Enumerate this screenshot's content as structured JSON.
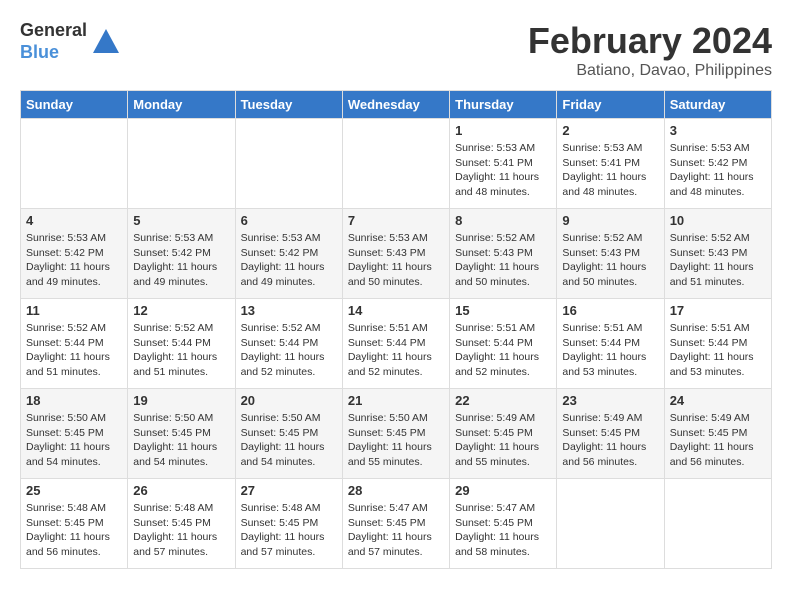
{
  "header": {
    "logo_line1": "General",
    "logo_line2": "Blue",
    "month_year": "February 2024",
    "location": "Batiano, Davao, Philippines"
  },
  "days_of_week": [
    "Sunday",
    "Monday",
    "Tuesday",
    "Wednesday",
    "Thursday",
    "Friday",
    "Saturday"
  ],
  "weeks": [
    [
      {
        "num": "",
        "info": ""
      },
      {
        "num": "",
        "info": ""
      },
      {
        "num": "",
        "info": ""
      },
      {
        "num": "",
        "info": ""
      },
      {
        "num": "1",
        "info": "Sunrise: 5:53 AM\nSunset: 5:41 PM\nDaylight: 11 hours\nand 48 minutes."
      },
      {
        "num": "2",
        "info": "Sunrise: 5:53 AM\nSunset: 5:41 PM\nDaylight: 11 hours\nand 48 minutes."
      },
      {
        "num": "3",
        "info": "Sunrise: 5:53 AM\nSunset: 5:42 PM\nDaylight: 11 hours\nand 48 minutes."
      }
    ],
    [
      {
        "num": "4",
        "info": "Sunrise: 5:53 AM\nSunset: 5:42 PM\nDaylight: 11 hours\nand 49 minutes."
      },
      {
        "num": "5",
        "info": "Sunrise: 5:53 AM\nSunset: 5:42 PM\nDaylight: 11 hours\nand 49 minutes."
      },
      {
        "num": "6",
        "info": "Sunrise: 5:53 AM\nSunset: 5:42 PM\nDaylight: 11 hours\nand 49 minutes."
      },
      {
        "num": "7",
        "info": "Sunrise: 5:53 AM\nSunset: 5:43 PM\nDaylight: 11 hours\nand 50 minutes."
      },
      {
        "num": "8",
        "info": "Sunrise: 5:52 AM\nSunset: 5:43 PM\nDaylight: 11 hours\nand 50 minutes."
      },
      {
        "num": "9",
        "info": "Sunrise: 5:52 AM\nSunset: 5:43 PM\nDaylight: 11 hours\nand 50 minutes."
      },
      {
        "num": "10",
        "info": "Sunrise: 5:52 AM\nSunset: 5:43 PM\nDaylight: 11 hours\nand 51 minutes."
      }
    ],
    [
      {
        "num": "11",
        "info": "Sunrise: 5:52 AM\nSunset: 5:44 PM\nDaylight: 11 hours\nand 51 minutes."
      },
      {
        "num": "12",
        "info": "Sunrise: 5:52 AM\nSunset: 5:44 PM\nDaylight: 11 hours\nand 51 minutes."
      },
      {
        "num": "13",
        "info": "Sunrise: 5:52 AM\nSunset: 5:44 PM\nDaylight: 11 hours\nand 52 minutes."
      },
      {
        "num": "14",
        "info": "Sunrise: 5:51 AM\nSunset: 5:44 PM\nDaylight: 11 hours\nand 52 minutes."
      },
      {
        "num": "15",
        "info": "Sunrise: 5:51 AM\nSunset: 5:44 PM\nDaylight: 11 hours\nand 52 minutes."
      },
      {
        "num": "16",
        "info": "Sunrise: 5:51 AM\nSunset: 5:44 PM\nDaylight: 11 hours\nand 53 minutes."
      },
      {
        "num": "17",
        "info": "Sunrise: 5:51 AM\nSunset: 5:44 PM\nDaylight: 11 hours\nand 53 minutes."
      }
    ],
    [
      {
        "num": "18",
        "info": "Sunrise: 5:50 AM\nSunset: 5:45 PM\nDaylight: 11 hours\nand 54 minutes."
      },
      {
        "num": "19",
        "info": "Sunrise: 5:50 AM\nSunset: 5:45 PM\nDaylight: 11 hours\nand 54 minutes."
      },
      {
        "num": "20",
        "info": "Sunrise: 5:50 AM\nSunset: 5:45 PM\nDaylight: 11 hours\nand 54 minutes."
      },
      {
        "num": "21",
        "info": "Sunrise: 5:50 AM\nSunset: 5:45 PM\nDaylight: 11 hours\nand 55 minutes."
      },
      {
        "num": "22",
        "info": "Sunrise: 5:49 AM\nSunset: 5:45 PM\nDaylight: 11 hours\nand 55 minutes."
      },
      {
        "num": "23",
        "info": "Sunrise: 5:49 AM\nSunset: 5:45 PM\nDaylight: 11 hours\nand 56 minutes."
      },
      {
        "num": "24",
        "info": "Sunrise: 5:49 AM\nSunset: 5:45 PM\nDaylight: 11 hours\nand 56 minutes."
      }
    ],
    [
      {
        "num": "25",
        "info": "Sunrise: 5:48 AM\nSunset: 5:45 PM\nDaylight: 11 hours\nand 56 minutes."
      },
      {
        "num": "26",
        "info": "Sunrise: 5:48 AM\nSunset: 5:45 PM\nDaylight: 11 hours\nand 57 minutes."
      },
      {
        "num": "27",
        "info": "Sunrise: 5:48 AM\nSunset: 5:45 PM\nDaylight: 11 hours\nand 57 minutes."
      },
      {
        "num": "28",
        "info": "Sunrise: 5:47 AM\nSunset: 5:45 PM\nDaylight: 11 hours\nand 57 minutes."
      },
      {
        "num": "29",
        "info": "Sunrise: 5:47 AM\nSunset: 5:45 PM\nDaylight: 11 hours\nand 58 minutes."
      },
      {
        "num": "",
        "info": ""
      },
      {
        "num": "",
        "info": ""
      }
    ]
  ]
}
